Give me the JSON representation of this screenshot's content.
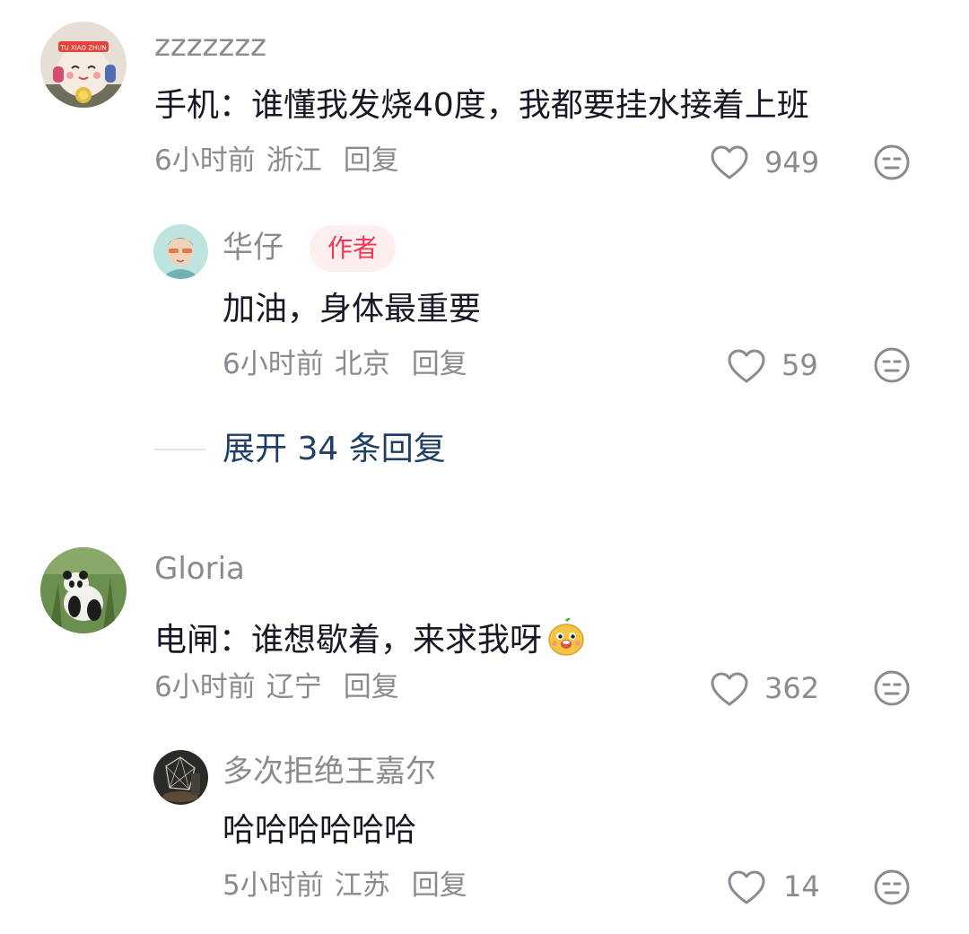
{
  "comments": [
    {
      "username": "zzzzzzz",
      "content": "手机：谁懂我发烧40度，我都要挂水接着上班",
      "time": "6小时前",
      "location": "浙江",
      "reply_label": "回复",
      "likes": "949",
      "avatar": "plush-toy-avatar",
      "avatar_text": "TU XIAO ZHUN",
      "replies": [
        {
          "username": "华仔",
          "badge": "作者",
          "content": "加油，身体最重要",
          "time": "6小时前",
          "location": "北京",
          "reply_label": "回复",
          "likes": "59",
          "avatar": "illustrated-man-avatar"
        }
      ],
      "expand_label": "展开 34 条回复"
    },
    {
      "username": "Gloria",
      "content": "电闸：谁想歇着，来求我呀",
      "emoji": "smiling-potato-emoji",
      "time": "6小时前",
      "location": "辽宁",
      "reply_label": "回复",
      "likes": "362",
      "avatar": "panda-avatar",
      "replies": [
        {
          "username": "多次拒绝王嘉尔",
          "content": "哈哈哈哈哈哈",
          "time": "5小时前",
          "location": "江苏",
          "reply_label": "回复",
          "likes": "14",
          "avatar": "dark-photo-avatar"
        }
      ]
    }
  ],
  "colors": {
    "text": "#161823",
    "meta": "#8a8b91",
    "badge_text": "#f2374f",
    "badge_bg": "#fdeef0",
    "expand": "#1f3f66"
  },
  "icons": {
    "like": "heart-outline-icon",
    "dislike": "meh-face-icon"
  }
}
